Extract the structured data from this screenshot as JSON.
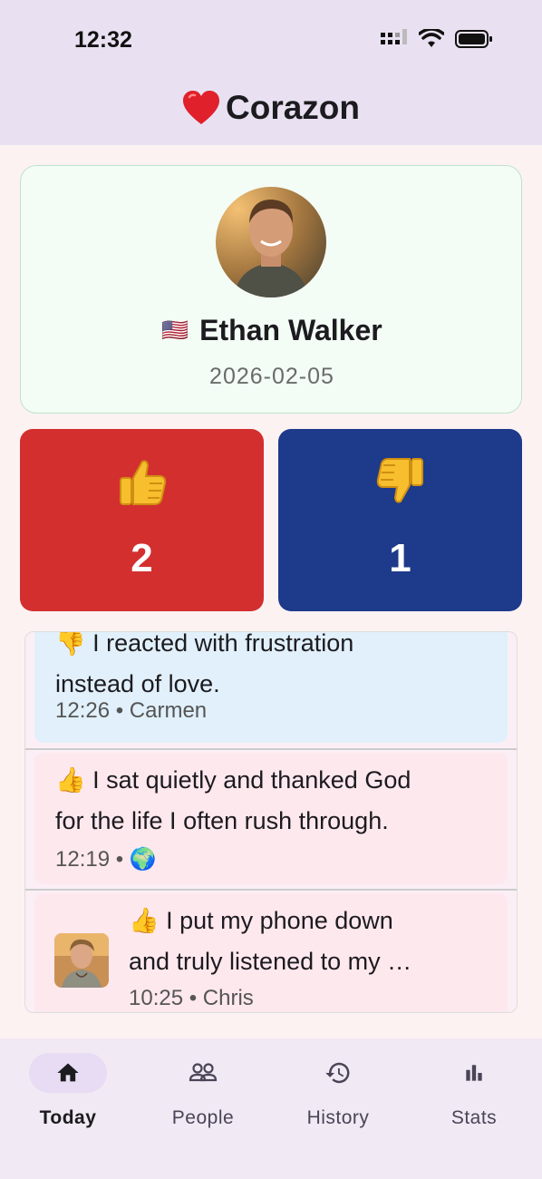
{
  "status_bar": {
    "time": "12:32"
  },
  "app": {
    "title": "Corazon",
    "logo_icon": "heart-icon"
  },
  "profile": {
    "flag": "🇺🇸",
    "name": "Ethan Walker",
    "date": "2026-02-05"
  },
  "counts": {
    "up": {
      "icon": "thumbs-up-icon",
      "value": "2",
      "color": "#d32f2f"
    },
    "down": {
      "icon": "thumbs-down-icon",
      "value": "1",
      "color": "#1e3a8a"
    }
  },
  "feed": {
    "entries": [
      {
        "emoji": "👎",
        "text": "I reacted with frustration instead of love.",
        "line1": "👎 I reacted with frustration",
        "line2": "instead of love.",
        "time": "12:26",
        "author": "Carmen",
        "meta": "12:26 • Carmen"
      },
      {
        "emoji": "👍",
        "text": "I sat quietly and thanked God for the life I often rush through.",
        "line1": "👍 I sat quietly and thanked God",
        "line2": "for the life I often rush through.",
        "time": "12:19",
        "author": "🌍",
        "meta": "12:19 • 🌍"
      },
      {
        "emoji": "👍",
        "text": "I put my phone down and truly listened to my …",
        "line1": "👍 I put my phone down",
        "line2": "and truly listened to my …",
        "time": "10:25",
        "author": "Chris",
        "meta": "10:25 • Chris"
      }
    ]
  },
  "nav": {
    "items": [
      {
        "label": "Today",
        "icon": "home-icon",
        "active": true
      },
      {
        "label": "People",
        "icon": "people-icon",
        "active": false
      },
      {
        "label": "History",
        "icon": "history-icon",
        "active": false
      },
      {
        "label": "Stats",
        "icon": "stats-icon",
        "active": false
      }
    ]
  }
}
